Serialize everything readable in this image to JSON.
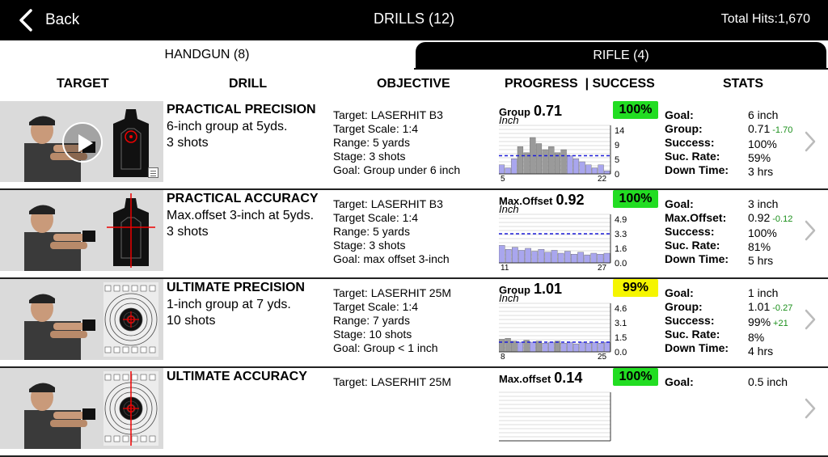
{
  "header": {
    "back_label": "Back",
    "title": "DRILLS (12)",
    "total_hits": "Total Hits:1,670"
  },
  "tabs": [
    {
      "label": "HANDGUN (8)",
      "active": true
    },
    {
      "label": "RIFLE (4)",
      "active": false
    }
  ],
  "columns": {
    "target": "TARGET",
    "drill": "DRILL",
    "objective": "OBJECTIVE",
    "progress": "PROGRESS  | SUCCESS",
    "stats": "STATS"
  },
  "rows": [
    {
      "name": "PRACTICAL PRECISION",
      "desc1": "6-inch group at 5yds.",
      "desc2": "3 shots",
      "obj": [
        "Target: LASERHIT B3",
        "Target Scale: 1:4",
        "Range: 5 yards",
        "Stage: 3 shots",
        "Goal: Group under 6 inch"
      ],
      "metric_label": "Group",
      "metric_value": "0.71",
      "metric_unit": "Inch",
      "success": "100%",
      "success_color": "#22dd22",
      "chart_data": {
        "type": "bar",
        "x_start": "5",
        "x_end": "22",
        "y_ticks": [
          "14",
          "9",
          "5",
          "0"
        ],
        "ylim": [
          0,
          16
        ],
        "goal": 6,
        "values": [
          3,
          2,
          5,
          9,
          7,
          12,
          10,
          8,
          9,
          7,
          8,
          6,
          5,
          4,
          3,
          2,
          3,
          1
        ]
      },
      "stats": {
        "labels": [
          "Goal:",
          "Group:",
          "Success:",
          "Suc. Rate:",
          "Down Time:"
        ],
        "values": [
          "6 inch",
          "0.71",
          "100%",
          "59%",
          "3 hrs"
        ],
        "delta": "-1.70"
      },
      "thumb": {
        "kind": "silhouette",
        "video": true
      }
    },
    {
      "name": "PRACTICAL ACCURACY",
      "desc1": "Max.offset 3-inch at 5yds.",
      "desc2": "3 shots",
      "obj": [
        "Target: LASERHIT B3",
        "Target Scale: 1:4",
        "Range: 5 yards",
        "Stage: 3 shots",
        "Goal: max offset 3-inch"
      ],
      "metric_label": "Max.Offset",
      "metric_value": "0.92",
      "metric_unit": "Inch",
      "success": "100%",
      "success_color": "#22dd22",
      "chart_data": {
        "type": "bar",
        "x_start": "11",
        "x_end": "27",
        "y_ticks": [
          "4.9",
          "3.3",
          "1.6",
          "0.0"
        ],
        "ylim": [
          0,
          5
        ],
        "goal": 3,
        "values": [
          1.8,
          1.4,
          1.6,
          1.3,
          1.5,
          1.2,
          1.4,
          1.1,
          1.3,
          1.0,
          1.2,
          0.9,
          1.1,
          0.8,
          1.0,
          0.9,
          1.0
        ]
      },
      "stats": {
        "labels": [
          "Goal:",
          "Max.Offset:",
          "Success:",
          "Suc. Rate:",
          "Down Time:"
        ],
        "values": [
          "3 inch",
          "0.92",
          "100%",
          "81%",
          "5 hrs"
        ],
        "delta": "-0.12"
      },
      "thumb": {
        "kind": "crosshair",
        "video": false
      }
    },
    {
      "name": "ULTIMATE PRECISION",
      "desc1": "1-inch group at 7 yds.",
      "desc2": "10 shots",
      "obj": [
        "Target: LASERHIT 25M",
        "Target Scale: 1:4",
        "Range: 7 yards",
        "Stage: 10 shots",
        "Goal: Group < 1 inch"
      ],
      "metric_label": "Group",
      "metric_value": "1.01",
      "metric_unit": "Inch",
      "success": "99%",
      "success_color": "#f5f500",
      "success_delta": "+21",
      "chart_data": {
        "type": "bar",
        "x_start": "8",
        "x_end": "25",
        "y_ticks": [
          "4.6",
          "3.1",
          "1.5",
          "0.0"
        ],
        "ylim": [
          0,
          5
        ],
        "goal": 1,
        "values": [
          1.3,
          1.4,
          1.1,
          1.0,
          1.2,
          1.0,
          1.1,
          0.9,
          1.0,
          1.1,
          0.9,
          1.0,
          0.8,
          1.0,
          0.9,
          1.0,
          0.9,
          1.0
        ]
      },
      "stats": {
        "labels": [
          "Goal:",
          "Group:",
          "Success:",
          "Suc. Rate:",
          "Down Time:"
        ],
        "values": [
          "1 inch",
          "1.01",
          "99%",
          "8%",
          "4 hrs"
        ],
        "delta": "-0.27"
      },
      "thumb": {
        "kind": "bullseye",
        "video": false
      }
    },
    {
      "name": "ULTIMATE ACCURACY",
      "desc1": "",
      "desc2": "",
      "obj": [
        "Target: LASERHIT 25M",
        "",
        "",
        "",
        ""
      ],
      "metric_label": "Max.offset",
      "metric_value": "0.14",
      "metric_unit": "",
      "success": "100%",
      "success_color": "#22dd22",
      "chart_data": {
        "type": "bar",
        "x_start": "",
        "x_end": "",
        "y_ticks": [],
        "ylim": [
          0,
          1
        ],
        "goal": 0,
        "values": []
      },
      "stats": {
        "labels": [
          "Goal:",
          "",
          "",
          "",
          ""
        ],
        "values": [
          "0.5 inch",
          "",
          "",
          "",
          ""
        ],
        "delta": ""
      },
      "thumb": {
        "kind": "crosshair-bullseye",
        "video": false
      }
    }
  ]
}
